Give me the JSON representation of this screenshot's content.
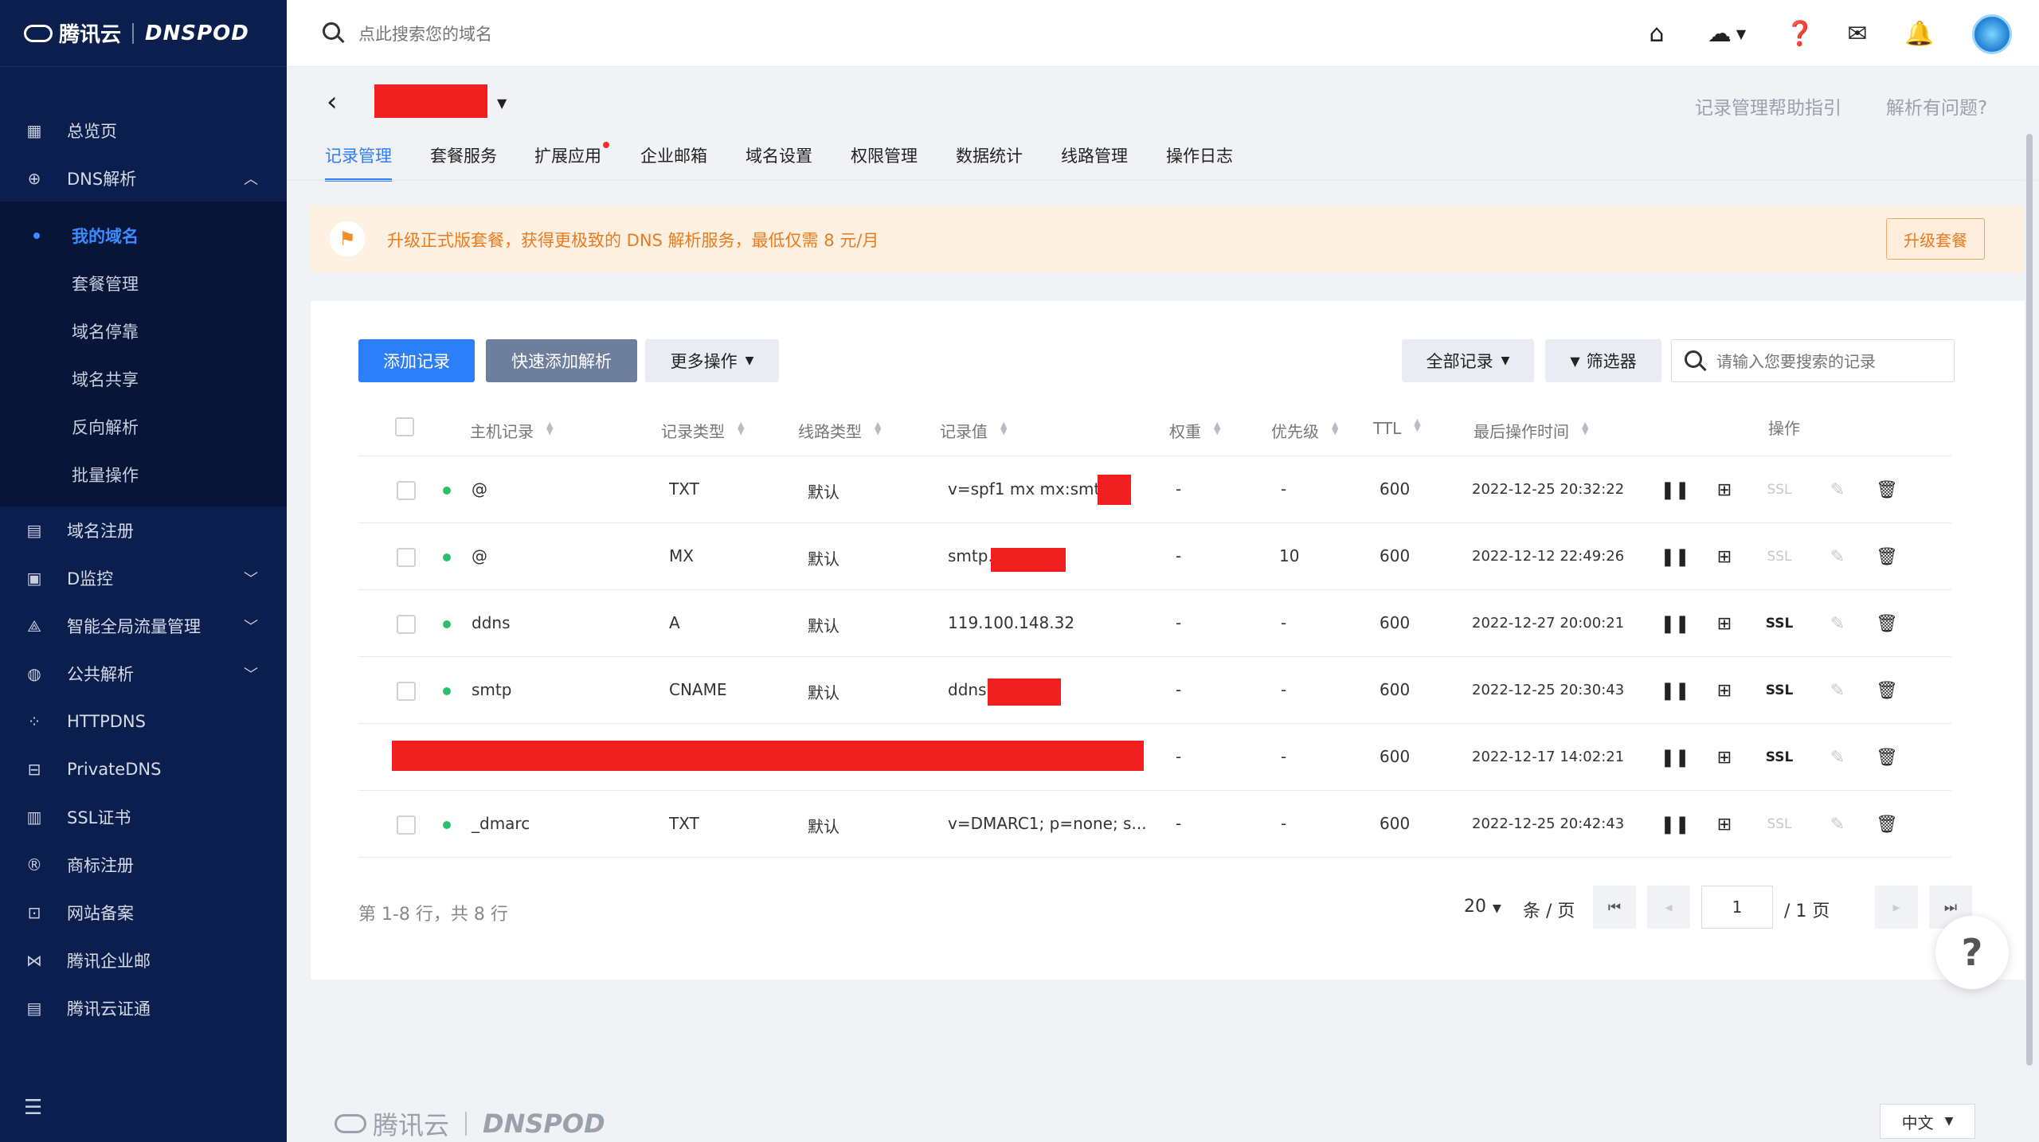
{
  "app": {
    "brand": "腾讯云",
    "product": "DNSPOD"
  },
  "sidebar": {
    "items": [
      {
        "name": "overview",
        "label": "总览页",
        "icon": "grid-icon"
      },
      {
        "name": "dns",
        "label": "DNS解析",
        "icon": "globe-icon"
      },
      {
        "name": "domain-register",
        "label": "域名注册",
        "icon": "register-icon"
      },
      {
        "name": "d-monitor",
        "label": "D监控",
        "icon": "monitor-icon"
      },
      {
        "name": "traffic",
        "label": "智能全局流量管理",
        "icon": "traffic-icon"
      },
      {
        "name": "public-dns",
        "label": "公共解析",
        "icon": "public-dns-icon"
      },
      {
        "name": "httpdns",
        "label": "HTTPDNS",
        "icon": "nodes-icon"
      },
      {
        "name": "privatedns",
        "label": "PrivateDNS",
        "icon": "lock-icon"
      },
      {
        "name": "ssl",
        "label": "SSL证书",
        "icon": "certificate-icon"
      },
      {
        "name": "trademark",
        "label": "商标注册",
        "icon": "registered-icon"
      },
      {
        "name": "icp",
        "label": "网站备案",
        "icon": "star-badge-icon"
      },
      {
        "name": "exmail",
        "label": "腾讯企业邮",
        "icon": "mail-icon"
      },
      {
        "name": "certpass",
        "label": "腾讯云证通",
        "icon": "id-card-icon"
      }
    ],
    "dns_sub": [
      "我的域名",
      "套餐管理",
      "域名停靠",
      "域名共享",
      "反向解析",
      "批量操作"
    ]
  },
  "header": {
    "search_placeholder": "点此搜索您的域名"
  },
  "domain_bar": {
    "help_link": "记录管理帮助指引",
    "issue_link": "解析有问题?"
  },
  "tabs": [
    "记录管理",
    "套餐服务",
    "扩展应用",
    "企业邮箱",
    "域名设置",
    "权限管理",
    "数据统计",
    "线路管理",
    "操作日志"
  ],
  "banner": {
    "text": "升级正式版套餐，获得更极致的 DNS 解析服务，最低仅需 8 元/月",
    "button": "升级套餐"
  },
  "toolbar": {
    "add": "添加记录",
    "quick_add": "快速添加解析",
    "more": "更多操作",
    "all_records": "全部记录",
    "filter": "筛选器",
    "search_placeholder": "请输入您要搜索的记录"
  },
  "table": {
    "headers": {
      "host": "主机记录",
      "type": "记录类型",
      "line": "线路类型",
      "value": "记录值",
      "weight": "权重",
      "priority": "优先级",
      "ttl": "TTL",
      "time": "最后操作时间",
      "ops": "操作"
    },
    "rows": [
      {
        "host": "@",
        "type": "TXT",
        "line": "默认",
        "value": "v=spf1 mx mx:smtp.",
        "weight": "-",
        "priority": "-",
        "ttl": "600",
        "time": "2022-12-25 20:32:22",
        "ssl": "SSL"
      },
      {
        "host": "@",
        "type": "MX",
        "line": "默认",
        "value": "smtp.",
        "weight": "-",
        "priority": "10",
        "ttl": "600",
        "time": "2022-12-12 22:49:26",
        "ssl": "SSL"
      },
      {
        "host": "ddns",
        "type": "A",
        "line": "默认",
        "value": "119.100.148.32",
        "weight": "-",
        "priority": "-",
        "ttl": "600",
        "time": "2022-12-27 20:00:21",
        "ssl": "SSL"
      },
      {
        "host": "smtp",
        "type": "CNAME",
        "line": "默认",
        "value": "ddns.",
        "weight": "-",
        "priority": "-",
        "ttl": "600",
        "time": "2022-12-25 20:30:43",
        "ssl": "SSL"
      },
      {
        "host": "",
        "type": "",
        "line": "",
        "value": "",
        "weight": "-",
        "priority": "-",
        "ttl": "600",
        "time": "2022-12-17 14:02:21",
        "ssl": "SSL"
      },
      {
        "host": "_dmarc",
        "type": "TXT",
        "line": "默认",
        "value": "v=DMARC1; p=none; s...",
        "weight": "-",
        "priority": "-",
        "ttl": "600",
        "time": "2022-12-25 20:42:43",
        "ssl": "SSL"
      }
    ]
  },
  "pagination": {
    "summary": "第 1-8 行，共 8 行",
    "page_size": "20",
    "per_page_label": "条 / 页",
    "current": "1",
    "total_label": "/ 1 页"
  },
  "footer": {
    "lang": "中文"
  },
  "colors": {
    "primary": "#2d7ff9",
    "sidebar": "#0b1f4e",
    "warning_text": "#ec7a1c",
    "success": "#2dbd6e"
  }
}
